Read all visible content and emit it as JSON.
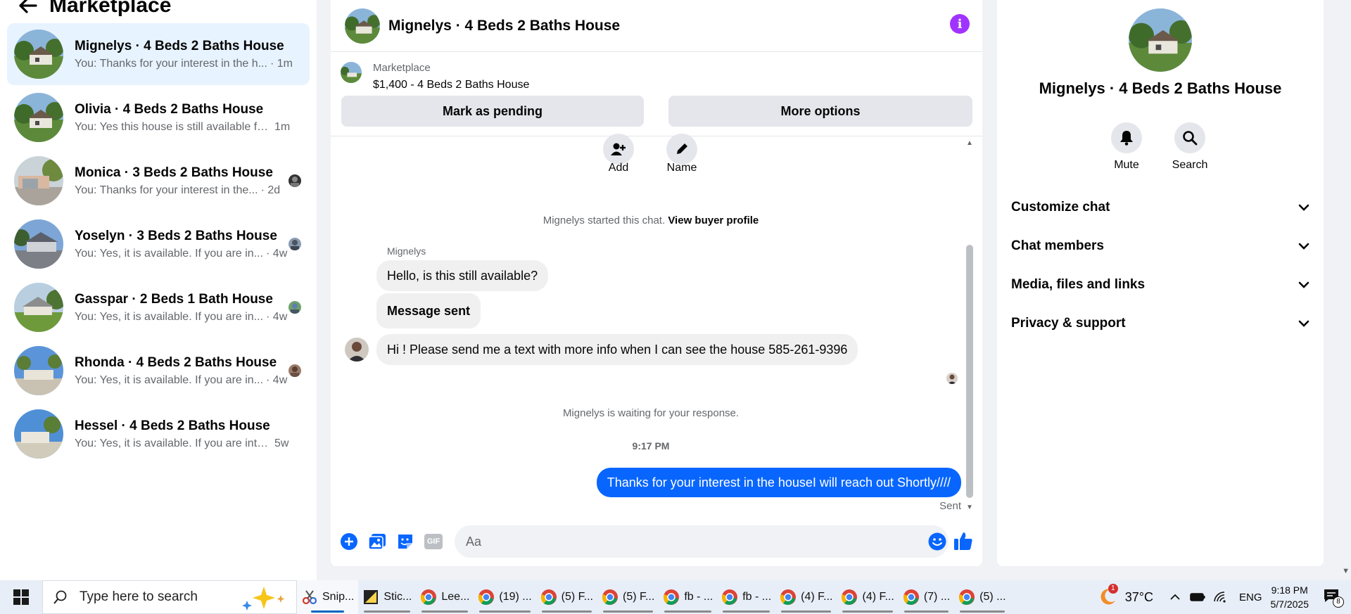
{
  "sidebar": {
    "title": "Marketplace",
    "conversations": [
      {
        "name": "Mignelys · 4 Beds 2 Baths House",
        "snippet": "You: Thanks for your interest in the h...",
        "time": "· 1m",
        "active": true
      },
      {
        "name": "Olivia · 4 Beds 2 Baths House",
        "snippet": "You: Yes this house is still available fo...",
        "time": "1m"
      },
      {
        "name": "Monica · 3 Beds 2 Baths House",
        "snippet": "You: Thanks for your interest in the...",
        "time": "· 2d"
      },
      {
        "name": "Yoselyn · 3 Beds 2 Baths House",
        "snippet": "You: Yes, it is available. If you are in...",
        "time": "· 4w"
      },
      {
        "name": "Gasspar · 2 Beds 1 Bath House",
        "snippet": "You: Yes, it is available. If you are in...",
        "time": "· 4w"
      },
      {
        "name": "Rhonda · 4 Beds 2 Baths House",
        "snippet": "You: Yes, it is available. If you are in...",
        "time": "· 4w"
      },
      {
        "name": "Hessel · 4 Beds 2 Baths House",
        "snippet": "You: Yes, it is available. If you are inter...",
        "time": "5w"
      }
    ]
  },
  "chat": {
    "title": "Mignelys · 4 Beds 2 Baths House",
    "listing": {
      "source": "Marketplace",
      "title": "$1,400 - 4 Beds 2 Baths House",
      "mark_pending": "Mark as pending",
      "more_options": "More options"
    },
    "actions": {
      "add": "Add",
      "name": "Name"
    },
    "started": "Mignelys started this chat.",
    "view_profile": "View buyer profile",
    "sender": "Mignelys",
    "incoming": [
      "Hello, is this still available?",
      "Message sent",
      "Hi ! Please send me a text  with more info when I can see the house 585-261-9396"
    ],
    "waiting": "Mignelys is waiting for your response.",
    "timestamp": "9:17 PM",
    "outgoing": "Thanks for your interest in the houseI will reach out Shortly////",
    "sent_label": "Sent",
    "composer_placeholder": "Aa",
    "gif_label": "GIF"
  },
  "details": {
    "name": "Mignelys · 4 Beds 2 Baths House",
    "mute": "Mute",
    "search": "Search",
    "sections": [
      "Customize chat",
      "Chat members",
      "Media, files and links",
      "Privacy & support"
    ]
  },
  "taskbar": {
    "search_placeholder": "Type here to search",
    "apps": [
      "Snip...",
      "Stic...",
      "Lee...",
      "(19) ...",
      "(5) F...",
      "(5) F...",
      "fb - ...",
      "fb - ...",
      "(4) F...",
      "(4) F...",
      "(7) ...",
      "(5) ..."
    ],
    "temperature": "37°C",
    "weather_badge": "1",
    "language": "ENG",
    "time": "9:18 PM",
    "date": "5/7/2025",
    "notifications": "8"
  },
  "colors": {
    "accent": "#0866ff",
    "active_conv": "#e7f3ff",
    "info": "#a033ff"
  }
}
